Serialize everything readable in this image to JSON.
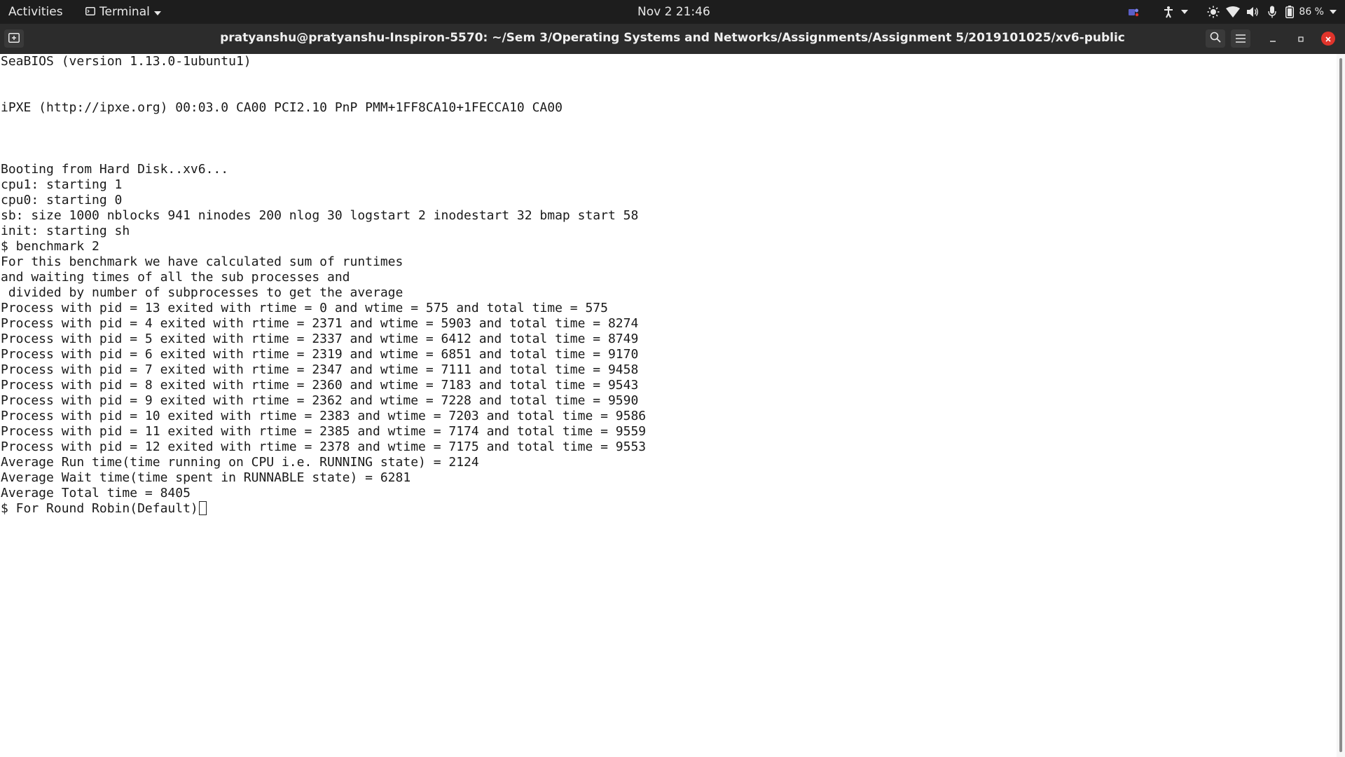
{
  "topbar": {
    "activities": "Activities",
    "app_name": "Terminal",
    "clock": "Nov 2  21:46",
    "battery": "86 %"
  },
  "window": {
    "title": "pratyanshu@pratyanshu-Inspiron-5570: ~/Sem 3/Operating Systems and Networks/Assignments/Assignment 5/2019101025/xv6-public"
  },
  "terminal": {
    "lines": [
      "SeaBIOS (version 1.13.0-1ubuntu1)",
      "",
      "",
      "iPXE (http://ipxe.org) 00:03.0 CA00 PCI2.10 PnP PMM+1FF8CA10+1FECCA10 CA00",
      "",
      "",
      "",
      "Booting from Hard Disk..xv6...",
      "cpu1: starting 1",
      "cpu0: starting 0",
      "sb: size 1000 nblocks 941 ninodes 200 nlog 30 logstart 2 inodestart 32 bmap start 58",
      "init: starting sh",
      "$ benchmark 2",
      "For this benchmark we have calculated sum of runtimes",
      "and waiting times of all the sub processes and",
      " divided by number of subprocesses to get the average",
      "Process with pid = 13 exited with rtime = 0 and wtime = 575 and total time = 575",
      "Process with pid = 4 exited with rtime = 2371 and wtime = 5903 and total time = 8274",
      "Process with pid = 5 exited with rtime = 2337 and wtime = 6412 and total time = 8749",
      "Process with pid = 6 exited with rtime = 2319 and wtime = 6851 and total time = 9170",
      "Process with pid = 7 exited with rtime = 2347 and wtime = 7111 and total time = 9458",
      "Process with pid = 8 exited with rtime = 2360 and wtime = 7183 and total time = 9543",
      "Process with pid = 9 exited with rtime = 2362 and wtime = 7228 and total time = 9590",
      "Process with pid = 10 exited with rtime = 2383 and wtime = 7203 and total time = 9586",
      "Process with pid = 11 exited with rtime = 2385 and wtime = 7174 and total time = 9559",
      "Process with pid = 12 exited with rtime = 2378 and wtime = 7175 and total time = 9553",
      "Average Run time(time running on CPU i.e. RUNNING state) = 2124",
      "Average Wait time(time spent in RUNNABLE state) = 6281",
      "Average Total time = 8405"
    ],
    "prompt_line": "$ For Round Robin(Default)"
  },
  "colors": {
    "topbar_bg": "#1d1d1d",
    "headerbar_bg": "#2c2c2c",
    "close_button": "#e0342b"
  },
  "icons": {
    "new_tab": "new-tab-icon",
    "search": "search-icon",
    "menu": "hamburger-menu-icon",
    "minimize": "minimize-icon",
    "maximize": "maximize-icon",
    "close": "close-icon"
  }
}
